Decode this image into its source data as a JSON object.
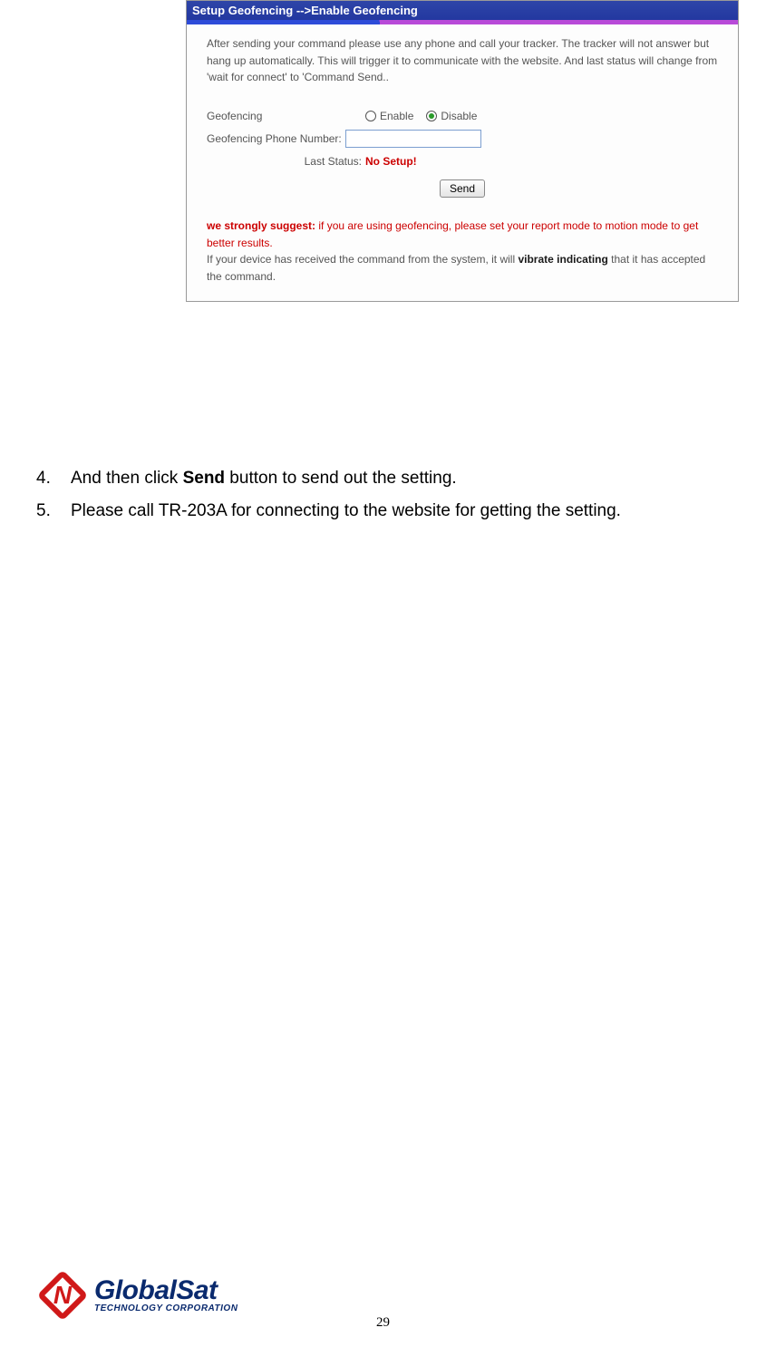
{
  "panel": {
    "title": "Setup Geofencing -->Enable Geofencing",
    "intro": "After sending your command please use any phone and call your tracker. The tracker will not answer but hang up automatically. This will trigger it to communicate with the website. And last status will change from 'wait for connect' to 'Command Send..",
    "geofencing_label": "Geofencing",
    "enable_label": "Enable",
    "disable_label": "Disable",
    "phone_label": "Geofencing Phone Number:",
    "phone_value": "",
    "status_label": "Last Status:",
    "status_value": "No Setup!",
    "send_label": "Send",
    "suggest_prefix": "we strongly suggest: ",
    "suggest_red_rest": "if you are using geofencing, please set your report mode to motion mode to get better results.",
    "suggest_line2_before": "If your device has received the command from the system, it will ",
    "suggest_vibrate": "vibrate indicating",
    "suggest_line2_after": " that it has accepted the command."
  },
  "instructions": {
    "item4_num": "4.",
    "item4_before": "And then click ",
    "item4_bold": "Send",
    "item4_after": " button to send out the setting.",
    "item5_num": "5.",
    "item5_text": "Please call TR-203A for connecting to the website for getting the setting."
  },
  "logo": {
    "main": "GlobalSat",
    "sub": "TECHNOLOGY CORPORATION"
  },
  "page_number": "29"
}
